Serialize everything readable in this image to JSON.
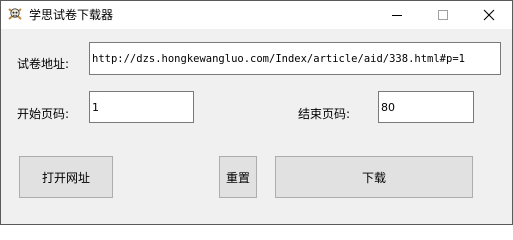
{
  "window": {
    "title": "学思试卷下载器",
    "app_icon": "skull-crossbones-icon",
    "controls": [
      "minimize-icon",
      "maximize-icon",
      "close-icon"
    ]
  },
  "form": {
    "url_label": "试卷地址:",
    "url_value": "http://dzs.hongkewangluo.com/Index/article/aid/338.html#p=1",
    "start_label": "开始页码:",
    "start_value": "1",
    "end_label": "结束页码:",
    "end_value": "80"
  },
  "buttons": {
    "open_url": "打开网址",
    "reset": "重置",
    "download": "下载"
  }
}
